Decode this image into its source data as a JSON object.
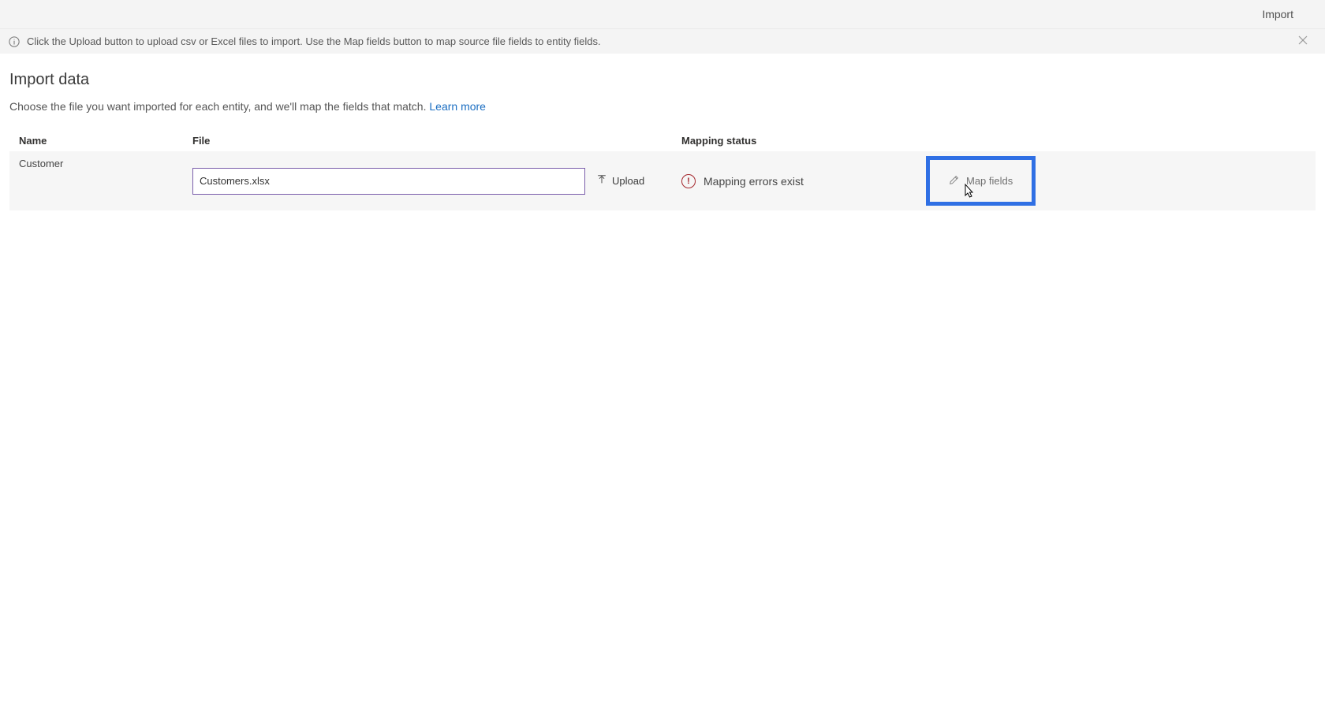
{
  "header": {
    "import_label": "Import"
  },
  "info_bar": {
    "text": "Click the Upload button to upload csv or Excel files to import. Use the Map fields button to map source file fields to entity fields."
  },
  "page": {
    "title": "Import data",
    "subtitle_prefix": "Choose the file you want imported for each entity, and we'll map the fields that match. ",
    "learn_more_label": "Learn more"
  },
  "grid": {
    "columns": {
      "name": "Name",
      "file": "File",
      "mapping_status": "Mapping status"
    },
    "rows": [
      {
        "name": "Customer",
        "file_value": "Customers.xlsx",
        "upload_label": "Upload",
        "status_text": "Mapping errors exist",
        "map_fields_label": "Map fields"
      }
    ]
  }
}
